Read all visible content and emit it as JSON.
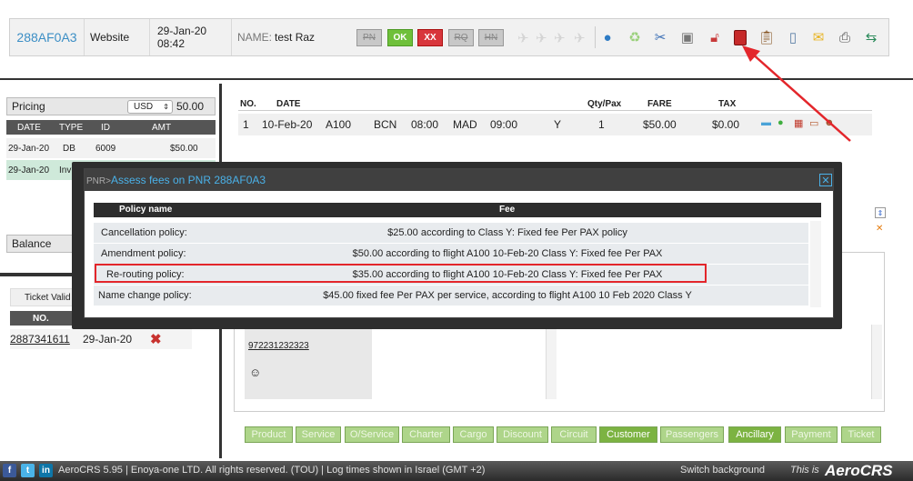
{
  "header": {
    "pnr_code": "288AF0A3",
    "source": "Website",
    "date": "29-Jan-20",
    "time": "08:42",
    "name_label": "NAME:",
    "name_value": "test Raz",
    "status_buttons": [
      "PN",
      "OK",
      "XX",
      "RQ",
      "HN"
    ],
    "tool_icons": [
      "globe-icon",
      "recycle-icon",
      "scissors-icon",
      "notepad-icon",
      "unlock-icon",
      "invoice-icon",
      "clipboard-icon",
      "phone-icon",
      "mail-icon",
      "printer-icon",
      "transfer-icon"
    ]
  },
  "pricing": {
    "label": "Pricing",
    "currency": "USD",
    "amount": "50.00",
    "columns": [
      "DATE",
      "TYPE",
      "ID",
      "AMT"
    ],
    "rows": [
      {
        "date": "29-Jan-20",
        "type": "DB",
        "id": "6009",
        "amt": "$50.00"
      },
      {
        "date": "29-Jan-20",
        "type": "Inv",
        "id": "",
        "amt": ""
      }
    ],
    "balance_label": "Balance"
  },
  "ticket": {
    "valid_label": "Ticket Valid",
    "col_no": "NO.",
    "number": "2887341611",
    "date": "29-Jan-20"
  },
  "segments": {
    "columns": [
      "NO.",
      "DATE",
      "Qty/Pax",
      "FARE",
      "TAX"
    ],
    "row": {
      "no": "1",
      "date": "10-Feb-20",
      "flight": "A100",
      "from": "BCN",
      "dep": "08:00",
      "to": "MAD",
      "arr": "09:00",
      "class": "Y",
      "qty": "1",
      "fare": "$50.00",
      "tax": "$0.00"
    }
  },
  "contact": {
    "phone": "972231232323"
  },
  "bottom_tabs": [
    "Product",
    "Service",
    "O/Service",
    "Charter",
    "Cargo",
    "Discount",
    "Circuit",
    "Customer",
    "Passengers",
    "Ancillary",
    "Payment",
    "Ticket"
  ],
  "modal": {
    "title_prefix": "PNR>",
    "title": "Assess fees on PNR 288AF0A3",
    "col_policy": "Policy name",
    "col_fee": "Fee",
    "policies": [
      {
        "name": "Cancellation policy:",
        "fee": "$25.00 according to Class Y: Fixed fee Per PAX policy"
      },
      {
        "name": "Amendment policy:",
        "fee": "$50.00 according to flight A100 10-Feb-20 Class Y: Fixed fee Per PAX"
      },
      {
        "name": "Re-routing policy:",
        "fee": "$35.00 according to flight A100 10-Feb-20 Class Y: Fixed fee Per PAX"
      },
      {
        "name": "Name change policy:",
        "fee": "$45.00 fixed fee Per PAX per service, according to flight A100 10 Feb 2020 Class Y"
      }
    ]
  },
  "footer": {
    "text": "AeroCRS 5.95  |  Enoya-one LTD. All rights reserved. (TOU)  |  Log times shown in Israel (GMT +2)",
    "switch_bg": "Switch background",
    "this_is": "This is",
    "brand": "AeroCRS"
  },
  "colors": {
    "accent_blue": "#3b8ec5",
    "ok_green": "#6fc03a",
    "xx_red": "#d8363c",
    "tab_green": "#aed58a",
    "highlight_red": "#e3262b"
  }
}
